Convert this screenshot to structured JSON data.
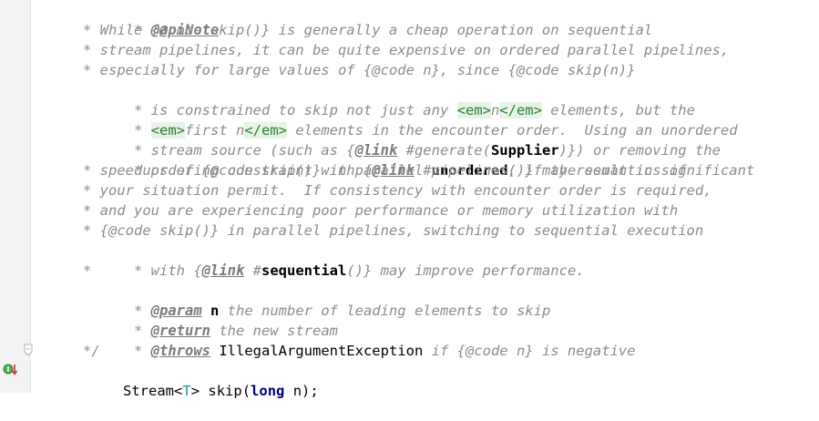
{
  "lines": [
    {
      "star": "* ",
      "tag": "@apiNote",
      "rest": ""
    },
    {
      "text": "* While {@code skip()} is generally a cheap operation on sequential"
    },
    {
      "text": "* stream pipelines, it can be quite expensive on ordered parallel pipelines,"
    },
    {
      "text": "* especially for large values of {@code n}, since {@code skip(n)}"
    },
    {
      "pre": "* is constrained to skip not just any ",
      "em_open": "<em>",
      "mid": "n",
      "em_close": "</em>",
      "post": " elements, but the"
    },
    {
      "pre": "* ",
      "em_open": "<em>",
      "mid": "first n",
      "em_close": "</em>",
      "post": " elements in the encounter order.  Using an unordered"
    },
    {
      "pre": "* stream source (such as {",
      "link": "@link",
      "ref_pre": " #generate(",
      "ref_bold": "Supplier",
      "ref_post": ")}) or removing the"
    },
    {
      "pre": "* ordering constraint with {",
      "link": "@link",
      "ref_pre": " #",
      "ref_bold": "unordered",
      "ref_post": "()} may result in significant"
    },
    {
      "text": "* speedups of {@code skip()} in parallel pipelines, if the semantics of"
    },
    {
      "text": "* your situation permit.  If consistency with encounter order is required,"
    },
    {
      "text": "* and you are experiencing poor performance or memory utilization with"
    },
    {
      "text": "* {@code skip()} in parallel pipelines, switching to sequential execution"
    },
    {
      "pre": "* with {",
      "link": "@link",
      "ref_pre": " #",
      "ref_bold": "sequential",
      "ref_post": "()} may improve performance."
    },
    {
      "text": "*"
    },
    {
      "star": "* ",
      "tag": "@param",
      "param": " n",
      "rest": " the number of leading elements to skip"
    },
    {
      "star": "* ",
      "tag": "@return",
      "rest": " the new stream"
    },
    {
      "star": "* ",
      "tag": "@throws",
      "exc": " IllegalArgumentException",
      "rest": " if {@code n} is negative"
    },
    {
      "text": "*/"
    }
  ],
  "code": {
    "type": "Stream",
    "lt": "<",
    "tparam": "T",
    "gt": ">",
    "method": " skip(",
    "kw": "long",
    "end": " n);"
  },
  "colors": {
    "comment": "#8c8c8c",
    "keyword": "#000080",
    "html_bg": "#e6f3e6",
    "type_param": "#20999d"
  }
}
